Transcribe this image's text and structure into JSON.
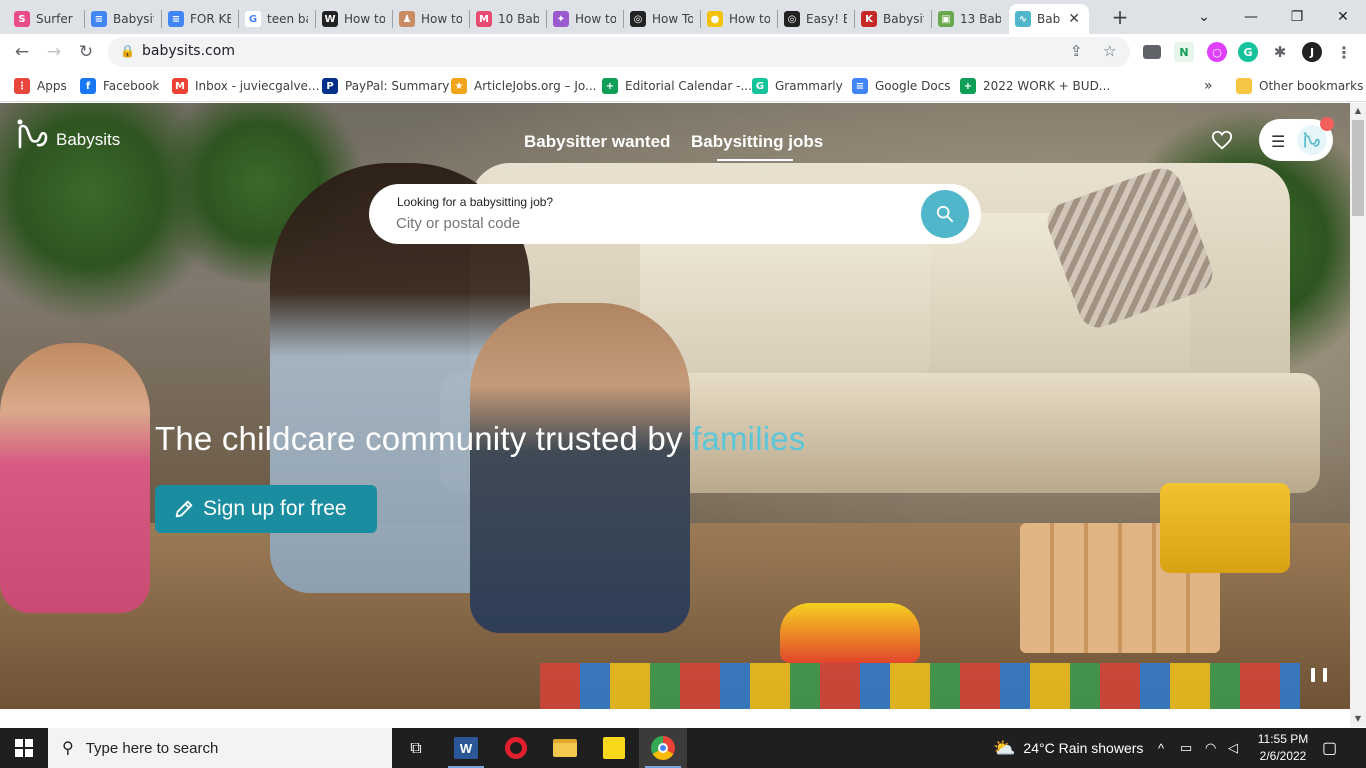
{
  "browser": {
    "tabs": [
      {
        "label": "Surfer -",
        "color": "#ea4c89",
        "glyph": "S"
      },
      {
        "label": "Babysit",
        "color": "#4285f4",
        "glyph": "≡"
      },
      {
        "label": "FOR KE",
        "color": "#4285f4",
        "glyph": "≡"
      },
      {
        "label": "teen ba",
        "color": "#ffffff",
        "glyph": "G"
      },
      {
        "label": "How to",
        "color": "#222222",
        "glyph": "W"
      },
      {
        "label": "How to",
        "color": "#c98b62",
        "glyph": "♟"
      },
      {
        "label": "10 Bab",
        "color": "#e84a73",
        "glyph": "M"
      },
      {
        "label": "How to",
        "color": "#9b59d0",
        "glyph": "✦"
      },
      {
        "label": "How To",
        "color": "#222222",
        "glyph": "◎"
      },
      {
        "label": "How to",
        "color": "#f4c20d",
        "glyph": "●"
      },
      {
        "label": "Easy! B",
        "color": "#222222",
        "glyph": "◎"
      },
      {
        "label": "Babysit",
        "color": "#c62828",
        "glyph": "K"
      },
      {
        "label": "13 Bab",
        "color": "#6aa84f",
        "glyph": "▣"
      },
      {
        "label": "Bab",
        "color": "#4fb7c9",
        "glyph": "∿"
      }
    ],
    "close_glyph": "✕",
    "new_tab_glyph": "+",
    "url": "babysits.com"
  },
  "bookmarks": [
    {
      "label": "Apps",
      "color": "#e8453c",
      "glyph": "⋮"
    },
    {
      "label": "Facebook",
      "color": "#1877f2",
      "glyph": "f"
    },
    {
      "label": "Inbox - juviecgalve...",
      "color": "#ea4335",
      "glyph": "M"
    },
    {
      "label": "PayPal: Summary",
      "color": "#003087",
      "glyph": "P"
    },
    {
      "label": "ArticleJobs.org – Jo...",
      "color": "#f1a51b",
      "glyph": "★"
    },
    {
      "label": "Editorial Calendar -...",
      "color": "#0f9d58",
      "glyph": "+"
    },
    {
      "label": "Grammarly",
      "color": "#15c39a",
      "glyph": "G"
    },
    {
      "label": "Google Docs",
      "color": "#4285f4",
      "glyph": "≡"
    },
    {
      "label": "2022 WORK + BUD...",
      "color": "#0f9d58",
      "glyph": "+"
    },
    {
      "label": "Other bookmarks",
      "color": "#f6c744",
      "glyph": ""
    }
  ],
  "bookmarks_overflow": "»",
  "site": {
    "logo_text": "Babysits",
    "nav": [
      {
        "label": "Babysitter wanted"
      },
      {
        "label": "Babysitting jobs"
      }
    ],
    "search": {
      "label": "Looking for a babysitting job?",
      "placeholder": "City or postal code"
    },
    "headline_main": "The childcare community trusted by ",
    "headline_accent": "families",
    "signup_label": "Sign up for free",
    "accent_color": "#5cc6d8",
    "button_color": "#1a8ea0"
  },
  "taskbar": {
    "search_placeholder": "Type here to search",
    "weather": "24°C  Rain showers",
    "time": "11:55 PM",
    "date": "2/6/2022"
  }
}
